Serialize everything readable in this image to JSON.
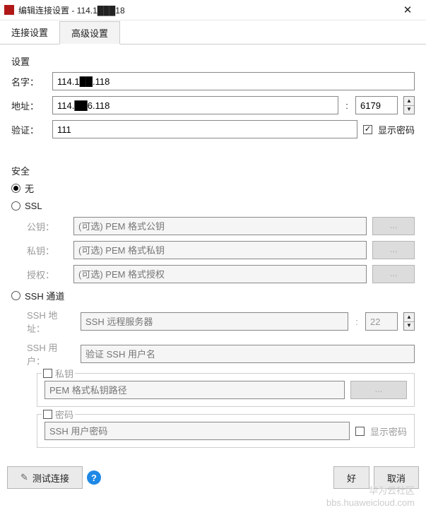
{
  "window": {
    "title": "编辑连接设置 - 114.1███18"
  },
  "tabs": {
    "connection": "连接设置",
    "advanced": "高级设置"
  },
  "settings": {
    "group": "设置",
    "name_label": "名字：",
    "name_value": "114.1██.118",
    "addr_label": "地址：",
    "addr_value": "114.██6.118",
    "port_value": "6179",
    "auth_label": "验证：",
    "auth_value": "111",
    "show_pw": "显示密码"
  },
  "security": {
    "group": "安全",
    "none": "无",
    "ssl": {
      "label": "SSL",
      "pub_label": "公钥：",
      "pub_ph": "(可选) PEM 格式公钥",
      "priv_label": "私钥：",
      "priv_ph": "(可选) PEM 格式私钥",
      "auth_label": "授权：",
      "auth_ph": "(可选) PEM 格式授权",
      "browse": "..."
    },
    "ssh": {
      "label": "SSH 通道",
      "addr_label": "SSH 地址：",
      "addr_ph": "SSH 远程服务器",
      "port": "22",
      "user_label": "SSH 用户：",
      "user_ph": "验证 SSH 用户名",
      "key_legend": "私钥",
      "key_ph": "PEM 格式私钥路径",
      "browse": "...",
      "pw_legend": "密码",
      "pw_ph": "SSH 用户密码",
      "show_pw": "显示密码"
    }
  },
  "footer": {
    "test": "测试连接",
    "ok": "好",
    "cancel": "取消"
  },
  "watermark": {
    "l1": "华为云社区",
    "l2": "bbs.huaweicloud.com"
  }
}
